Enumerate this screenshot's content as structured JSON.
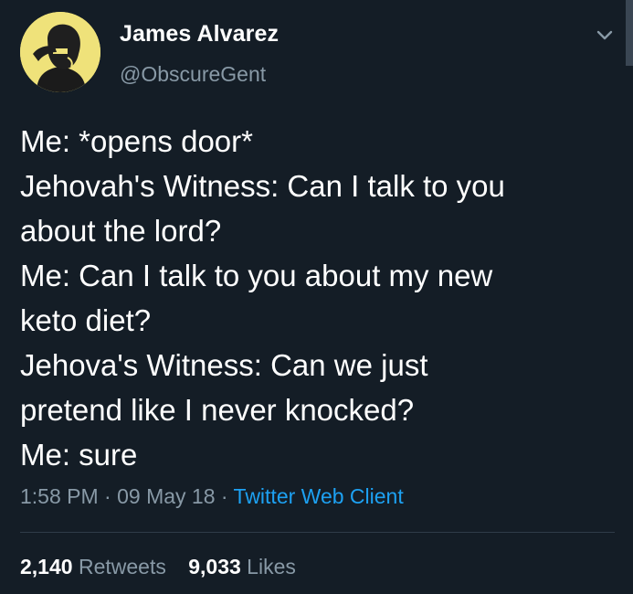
{
  "author": {
    "name": "James Alvarez",
    "handle": "@ObscureGent"
  },
  "tweet": {
    "lines": [
      "Me: *opens door*",
      "Jehovah's Witness: Can I talk to you",
      "about the lord?",
      "Me: Can I talk to you about my new",
      "keto diet?",
      "Jehova's Witness: Can we just",
      "pretend like I never knocked?",
      "Me: sure"
    ]
  },
  "meta": {
    "time": "1:58 PM",
    "separator": " · ",
    "date": "09 May 18",
    "client": "Twitter Web Client"
  },
  "stats": {
    "retweets_count": "2,140",
    "retweets_label": "Retweets",
    "likes_count": "9,033",
    "likes_label": "Likes"
  },
  "icons": {
    "avatar": "user-avatar",
    "menu": "chevron-down-icon"
  },
  "colors": {
    "background": "#141d26",
    "secondary_text": "#8899a6",
    "link": "#1da1f2",
    "avatar_bg": "#efe27a"
  }
}
